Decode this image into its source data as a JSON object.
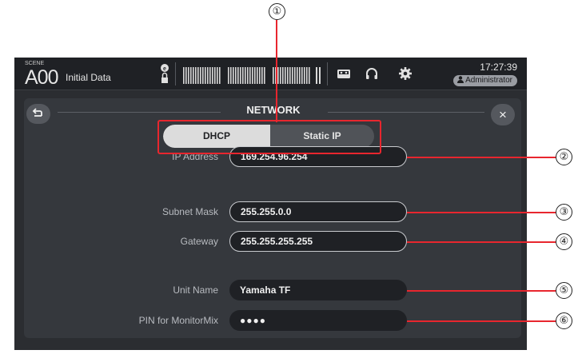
{
  "topbar": {
    "scene_caption": "SCENE",
    "scene_number": "A00",
    "scene_name": "Initial Data",
    "clock": "17:27:39",
    "user": "Administrator",
    "icons": [
      "lock-icon",
      "recorder-icon",
      "headphones-icon",
      "gear-icon",
      "user-icon"
    ]
  },
  "dialog": {
    "title": "NETWORK",
    "back_icon": "back-arrow-icon",
    "close_label": "×",
    "mode": {
      "options": [
        "DHCP",
        "Static IP"
      ],
      "selected": "DHCP"
    },
    "fields": [
      {
        "label": "IP Address",
        "value": "169.254.96.254"
      },
      {
        "label": "Subnet Mask",
        "value": "255.255.0.0"
      },
      {
        "label": "Gateway",
        "value": "255.255.255.255"
      },
      {
        "label": "Unit Name",
        "value": "Yamaha TF"
      },
      {
        "label": "PIN for MonitorMix",
        "value": "●●●●"
      }
    ]
  },
  "callouts": [
    "①",
    "②",
    "③",
    "④",
    "⑤",
    "⑥"
  ],
  "colors": {
    "callout": "#e8262e",
    "panel": "#35383d",
    "selected_segment": "#dcdcdc"
  }
}
